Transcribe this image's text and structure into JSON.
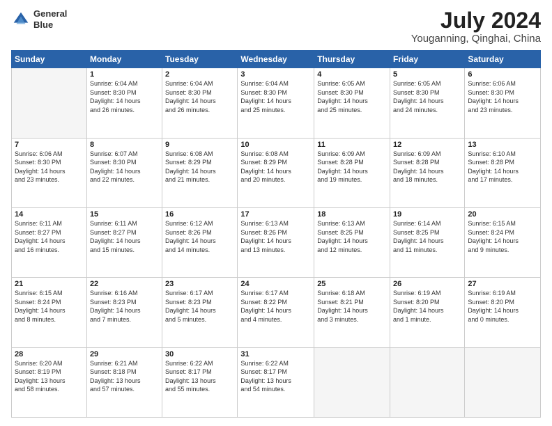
{
  "header": {
    "logo_line1": "General",
    "logo_line2": "Blue",
    "month_year": "July 2024",
    "location": "Youganning, Qinghai, China"
  },
  "days_of_week": [
    "Sunday",
    "Monday",
    "Tuesday",
    "Wednesday",
    "Thursday",
    "Friday",
    "Saturday"
  ],
  "weeks": [
    [
      {
        "day": "",
        "info": ""
      },
      {
        "day": "1",
        "info": "Sunrise: 6:04 AM\nSunset: 8:30 PM\nDaylight: 14 hours\nand 26 minutes."
      },
      {
        "day": "2",
        "info": "Sunrise: 6:04 AM\nSunset: 8:30 PM\nDaylight: 14 hours\nand 26 minutes."
      },
      {
        "day": "3",
        "info": "Sunrise: 6:04 AM\nSunset: 8:30 PM\nDaylight: 14 hours\nand 25 minutes."
      },
      {
        "day": "4",
        "info": "Sunrise: 6:05 AM\nSunset: 8:30 PM\nDaylight: 14 hours\nand 25 minutes."
      },
      {
        "day": "5",
        "info": "Sunrise: 6:05 AM\nSunset: 8:30 PM\nDaylight: 14 hours\nand 24 minutes."
      },
      {
        "day": "6",
        "info": "Sunrise: 6:06 AM\nSunset: 8:30 PM\nDaylight: 14 hours\nand 23 minutes."
      }
    ],
    [
      {
        "day": "7",
        "info": "Sunrise: 6:06 AM\nSunset: 8:30 PM\nDaylight: 14 hours\nand 23 minutes."
      },
      {
        "day": "8",
        "info": "Sunrise: 6:07 AM\nSunset: 8:30 PM\nDaylight: 14 hours\nand 22 minutes."
      },
      {
        "day": "9",
        "info": "Sunrise: 6:08 AM\nSunset: 8:29 PM\nDaylight: 14 hours\nand 21 minutes."
      },
      {
        "day": "10",
        "info": "Sunrise: 6:08 AM\nSunset: 8:29 PM\nDaylight: 14 hours\nand 20 minutes."
      },
      {
        "day": "11",
        "info": "Sunrise: 6:09 AM\nSunset: 8:28 PM\nDaylight: 14 hours\nand 19 minutes."
      },
      {
        "day": "12",
        "info": "Sunrise: 6:09 AM\nSunset: 8:28 PM\nDaylight: 14 hours\nand 18 minutes."
      },
      {
        "day": "13",
        "info": "Sunrise: 6:10 AM\nSunset: 8:28 PM\nDaylight: 14 hours\nand 17 minutes."
      }
    ],
    [
      {
        "day": "14",
        "info": "Sunrise: 6:11 AM\nSunset: 8:27 PM\nDaylight: 14 hours\nand 16 minutes."
      },
      {
        "day": "15",
        "info": "Sunrise: 6:11 AM\nSunset: 8:27 PM\nDaylight: 14 hours\nand 15 minutes."
      },
      {
        "day": "16",
        "info": "Sunrise: 6:12 AM\nSunset: 8:26 PM\nDaylight: 14 hours\nand 14 minutes."
      },
      {
        "day": "17",
        "info": "Sunrise: 6:13 AM\nSunset: 8:26 PM\nDaylight: 14 hours\nand 13 minutes."
      },
      {
        "day": "18",
        "info": "Sunrise: 6:13 AM\nSunset: 8:25 PM\nDaylight: 14 hours\nand 12 minutes."
      },
      {
        "day": "19",
        "info": "Sunrise: 6:14 AM\nSunset: 8:25 PM\nDaylight: 14 hours\nand 11 minutes."
      },
      {
        "day": "20",
        "info": "Sunrise: 6:15 AM\nSunset: 8:24 PM\nDaylight: 14 hours\nand 9 minutes."
      }
    ],
    [
      {
        "day": "21",
        "info": "Sunrise: 6:15 AM\nSunset: 8:24 PM\nDaylight: 14 hours\nand 8 minutes."
      },
      {
        "day": "22",
        "info": "Sunrise: 6:16 AM\nSunset: 8:23 PM\nDaylight: 14 hours\nand 7 minutes."
      },
      {
        "day": "23",
        "info": "Sunrise: 6:17 AM\nSunset: 8:23 PM\nDaylight: 14 hours\nand 5 minutes."
      },
      {
        "day": "24",
        "info": "Sunrise: 6:17 AM\nSunset: 8:22 PM\nDaylight: 14 hours\nand 4 minutes."
      },
      {
        "day": "25",
        "info": "Sunrise: 6:18 AM\nSunset: 8:21 PM\nDaylight: 14 hours\nand 3 minutes."
      },
      {
        "day": "26",
        "info": "Sunrise: 6:19 AM\nSunset: 8:20 PM\nDaylight: 14 hours\nand 1 minute."
      },
      {
        "day": "27",
        "info": "Sunrise: 6:19 AM\nSunset: 8:20 PM\nDaylight: 14 hours\nand 0 minutes."
      }
    ],
    [
      {
        "day": "28",
        "info": "Sunrise: 6:20 AM\nSunset: 8:19 PM\nDaylight: 13 hours\nand 58 minutes."
      },
      {
        "day": "29",
        "info": "Sunrise: 6:21 AM\nSunset: 8:18 PM\nDaylight: 13 hours\nand 57 minutes."
      },
      {
        "day": "30",
        "info": "Sunrise: 6:22 AM\nSunset: 8:17 PM\nDaylight: 13 hours\nand 55 minutes."
      },
      {
        "day": "31",
        "info": "Sunrise: 6:22 AM\nSunset: 8:17 PM\nDaylight: 13 hours\nand 54 minutes."
      },
      {
        "day": "",
        "info": ""
      },
      {
        "day": "",
        "info": ""
      },
      {
        "day": "",
        "info": ""
      }
    ]
  ]
}
